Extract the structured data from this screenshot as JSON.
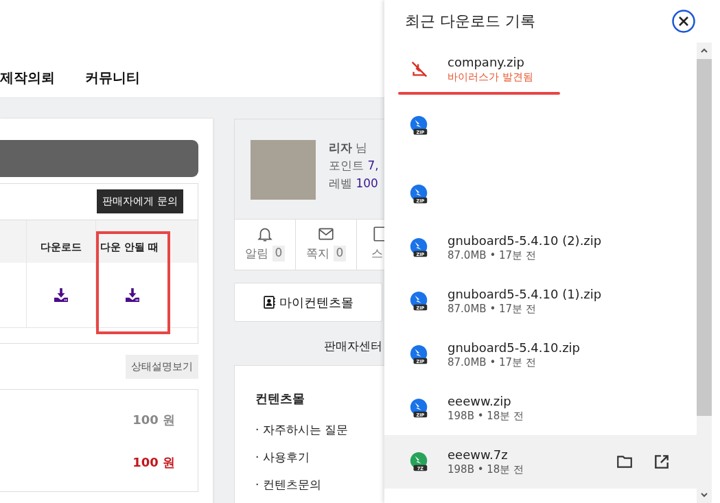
{
  "nav": [
    "제작의뢰",
    "커뮤니티"
  ],
  "inquiry_button": "판매자에게 문의",
  "table": {
    "columns": [
      {
        "label": "다운로드",
        "highlighted": false
      },
      {
        "label": "다운 안될 때",
        "highlighted": true
      }
    ]
  },
  "status_button": "상태설명보기",
  "prices": [
    {
      "text": "100 원",
      "kind": "regular"
    },
    {
      "text": "100 원",
      "kind": "sale"
    }
  ],
  "profile": {
    "name": "리자",
    "suffix": "님",
    "point_label": "포인트",
    "point_value": "7,",
    "level_label": "레벨",
    "level_value": "100"
  },
  "shortcuts": [
    {
      "label": "알림",
      "count": "0",
      "kind": "bell"
    },
    {
      "label": "쪽지",
      "count": "0",
      "kind": "mail"
    },
    {
      "label": "스",
      "kind": "book"
    }
  ],
  "my_button": "마이컨텐츠몰",
  "seller_center": "판매자센터",
  "contents_menu": {
    "title": "컨텐츠몰",
    "items": [
      "· 자주하시는 질문",
      "· 사용후기",
      "· 컨텐츠문의"
    ]
  },
  "downloads": {
    "title": "최근 다운로드 기록",
    "items": [
      {
        "kind": "blocked",
        "name": "company.zip",
        "detail": "바이러스가 발견됨",
        "underlined": true,
        "selected": false
      },
      {
        "kind": "archive",
        "badge": "ZIP",
        "color": "#1a73e8",
        "underlined": false,
        "selected": false
      },
      {
        "kind": "archive",
        "badge": "ZIP",
        "color": "#1a73e8",
        "underlined": false,
        "selected": false
      },
      {
        "kind": "archive",
        "badge": "ZIP",
        "color": "#1a73e8",
        "name": "gnuboard5-5.4.10 (2).zip",
        "detail": "87.0MB • 17분 전",
        "underlined": false,
        "selected": false
      },
      {
        "kind": "archive",
        "badge": "ZIP",
        "color": "#1a73e8",
        "name": "gnuboard5-5.4.10 (1).zip",
        "detail": "87.0MB • 17분 전",
        "underlined": false,
        "selected": false
      },
      {
        "kind": "archive",
        "badge": "ZIP",
        "color": "#1a73e8",
        "name": "gnuboard5-5.4.10.zip",
        "detail": "87.0MB • 17분 전",
        "underlined": false,
        "selected": false
      },
      {
        "kind": "archive",
        "badge": "ZIP",
        "color": "#1a73e8",
        "name": "eeeww.zip",
        "detail": "198B • 18분 전",
        "underlined": false,
        "selected": false
      },
      {
        "kind": "archive",
        "badge": "7Z",
        "color": "#27a35a",
        "name": "eeeww.7z",
        "detail": "198B • 18분 전",
        "underlined": false,
        "selected": true
      }
    ]
  }
}
